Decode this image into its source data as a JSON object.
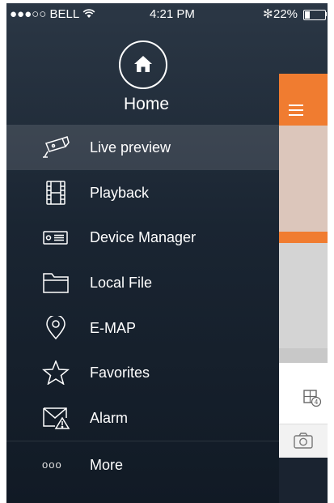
{
  "status_bar": {
    "signal": "●●●○○",
    "carrier": "BELL",
    "time": "4:21 PM",
    "battery_percent": "22%",
    "battery_level": 0.22
  },
  "header": {
    "icon": "home-icon",
    "title": "Home"
  },
  "menu": {
    "items": [
      {
        "label": "Live preview",
        "icon": "camera-icon",
        "active": true
      },
      {
        "label": "Playback",
        "icon": "film-icon",
        "active": false
      },
      {
        "label": "Device Manager",
        "icon": "dvr-icon",
        "active": false
      },
      {
        "label": "Local File",
        "icon": "folder-icon",
        "active": false
      },
      {
        "label": "E-MAP",
        "icon": "map-pin-icon",
        "active": false
      },
      {
        "label": "Favorites",
        "icon": "star-icon",
        "active": false
      },
      {
        "label": "Alarm",
        "icon": "alarm-envelope-icon",
        "active": false
      }
    ],
    "more": {
      "label": "More",
      "icon": "ellipsis-icon",
      "glyph": "ooo"
    }
  },
  "underlying_screen": {
    "split_badge": "4",
    "accent_color": "#f07c30"
  }
}
